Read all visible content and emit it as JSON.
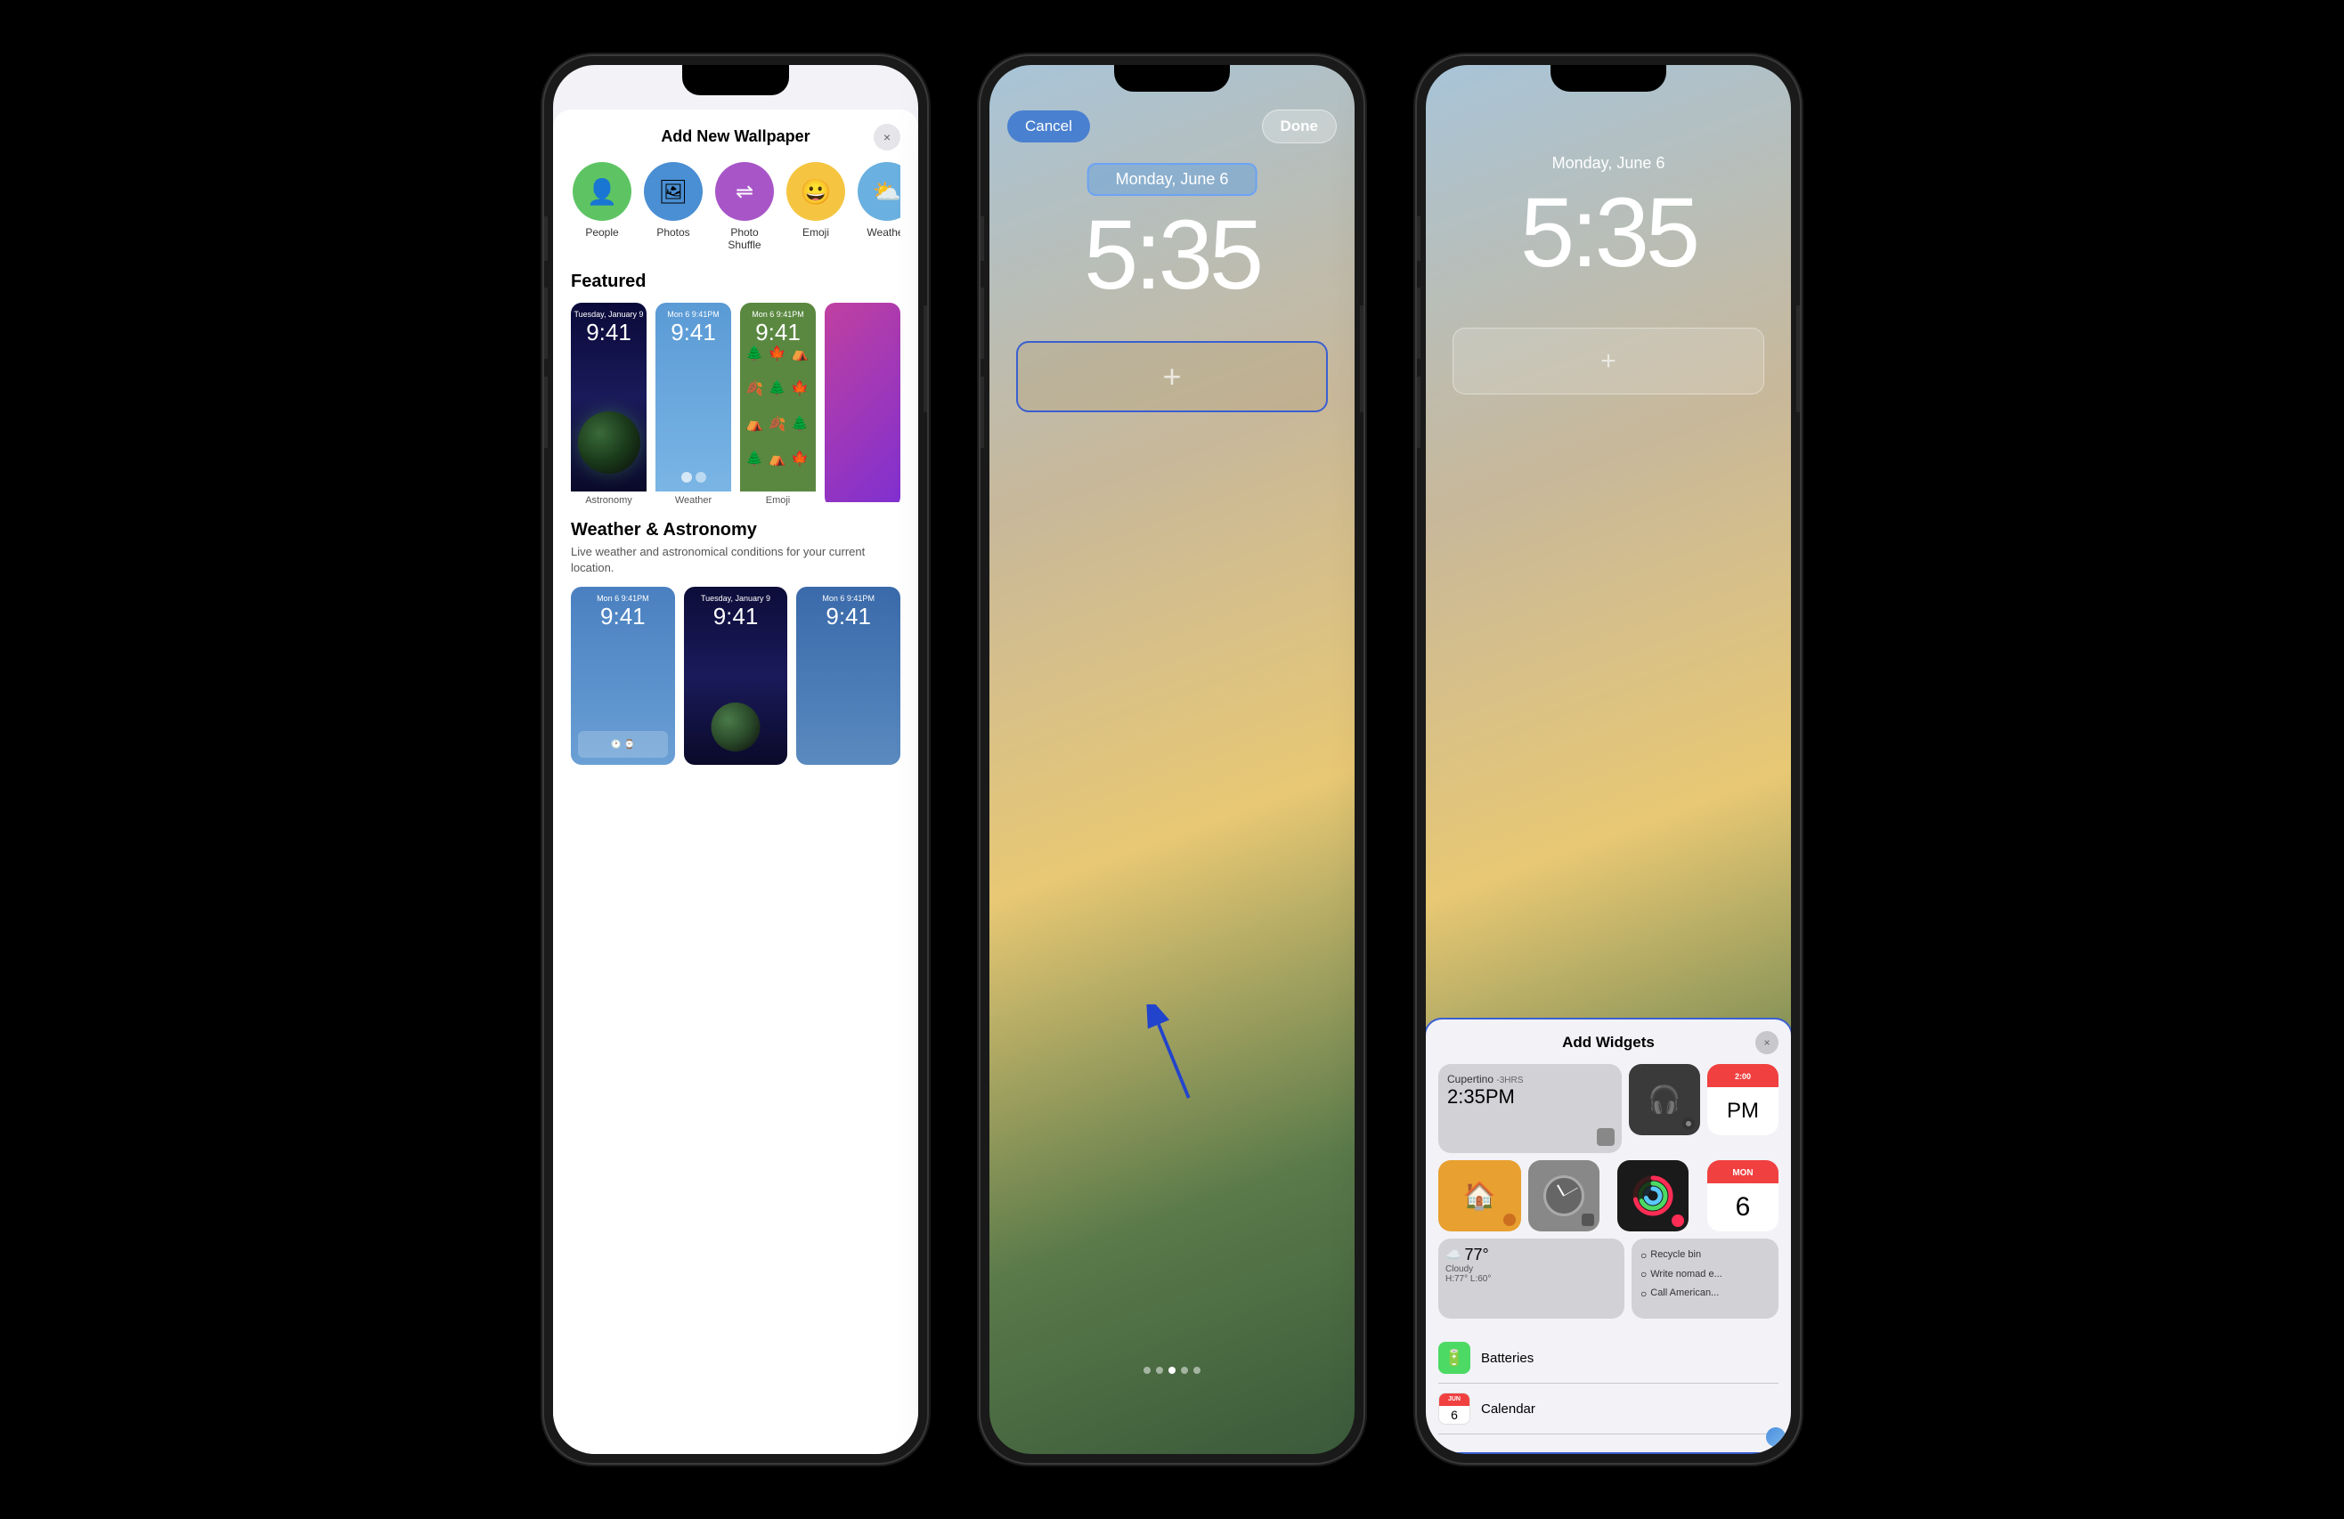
{
  "phone1": {
    "sheet_title": "Add New Wallpaper",
    "close_icon": "×",
    "icons": [
      {
        "label": "People",
        "emoji": "👤",
        "bg": "#5ec463"
      },
      {
        "label": "Photos",
        "emoji": "🖼",
        "bg": "#4a8fd4"
      },
      {
        "label": "Photo Shuffle",
        "emoji": "⇌",
        "bg": "#a855c8"
      },
      {
        "label": "Emoji",
        "emoji": "😀",
        "bg": "#f5c542"
      },
      {
        "label": "Weather",
        "emoji": "⛅",
        "bg": "#6ab0e0"
      }
    ],
    "featured_label": "Featured",
    "featured_items": [
      {
        "name": "Astronomy"
      },
      {
        "name": "Weather"
      },
      {
        "name": "Emoji"
      }
    ],
    "section2_title": "Weather & Astronomy",
    "section2_desc": "Live weather and astronomical conditions for your current location.",
    "weather_items": [
      {
        "name": "w1"
      },
      {
        "name": "w2"
      },
      {
        "name": "w3"
      }
    ]
  },
  "phone2": {
    "cancel_label": "Cancel",
    "done_label": "Done",
    "date": "Monday, June 6",
    "time": "5:35",
    "plus_icon": "+",
    "dots": [
      false,
      false,
      true,
      false,
      false
    ]
  },
  "phone3": {
    "date": "Monday, June 6",
    "time": "5:35",
    "plus_icon": "+",
    "widgets_panel": {
      "title": "Add Widgets",
      "close_icon": "×",
      "weather_city": "Cupertino",
      "weather_offset": "-3HRS",
      "weather_time": "2:35PM",
      "weather_temp": "77°",
      "weather_cond": "Cloudy",
      "weather_hl": "H:77° L:60°",
      "cal_day": "6",
      "cal_month": "MON",
      "reminder1": "Recycle bin",
      "reminder2": "Write nomad e...",
      "reminder3": "Call American...",
      "apps": [
        {
          "name": "Batteries",
          "icon": "🔋",
          "color": "#4cd964"
        },
        {
          "name": "Calendar",
          "icon": "📅",
          "color": "#fff"
        }
      ]
    }
  }
}
